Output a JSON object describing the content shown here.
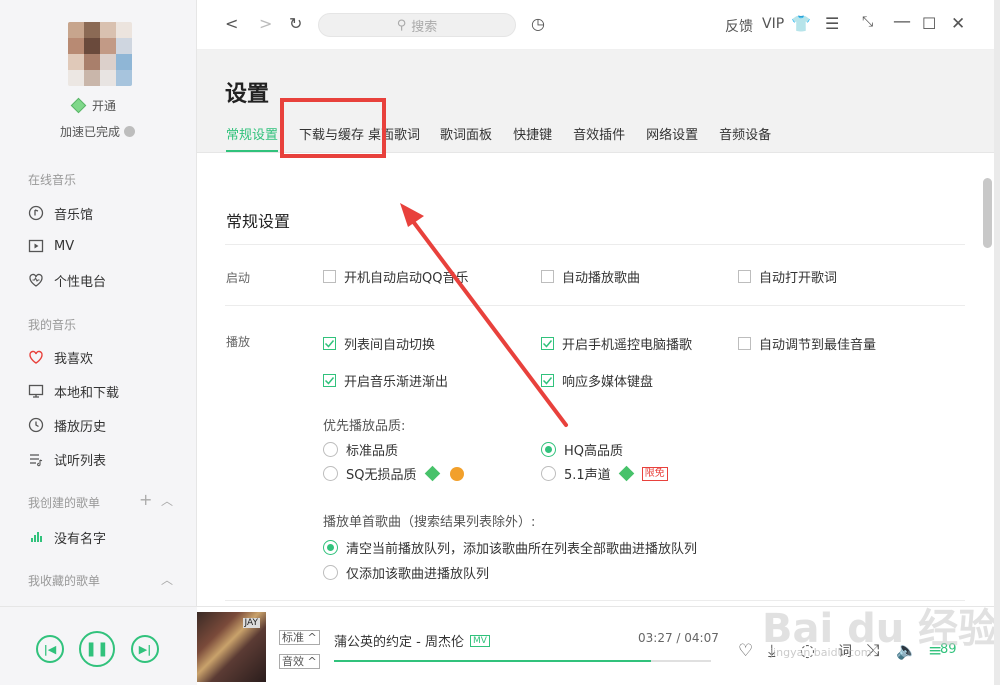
{
  "sidebar": {
    "vip_label": "开通",
    "speed_status": "加速已完成",
    "online_music_title": "在线音乐",
    "online_items": [
      {
        "label": "音乐馆",
        "icon": "music-hall-icon"
      },
      {
        "label": "MV",
        "icon": "mv-icon"
      },
      {
        "label": "个性电台",
        "icon": "radio-icon"
      }
    ],
    "my_music_title": "我的音乐",
    "my_items": [
      {
        "label": "我喜欢",
        "icon": "heart-icon"
      },
      {
        "label": "本地和下载",
        "icon": "monitor-icon"
      },
      {
        "label": "播放历史",
        "icon": "clock-icon"
      },
      {
        "label": "试听列表",
        "icon": "list-icon"
      }
    ],
    "created_title": "我创建的歌单",
    "created_item": "没有名字",
    "collected_title": "我收藏的歌单"
  },
  "topbar": {
    "search_placeholder": "搜索",
    "feedback": "反馈",
    "vip": "VIP"
  },
  "settings": {
    "title": "设置",
    "tabs": [
      "常规设置",
      "下载与缓存",
      "桌面歌词",
      "歌词面板",
      "快捷键",
      "音效插件",
      "网络设置",
      "音频设备"
    ],
    "active_tab": "常规设置",
    "section_title": "常规设置",
    "startup_label": "启动",
    "startup_options": [
      {
        "label": "开机自动启动QQ音乐",
        "checked": false
      },
      {
        "label": "自动播放歌曲",
        "checked": false
      },
      {
        "label": "自动打开歌词",
        "checked": false
      }
    ],
    "play_label": "播放",
    "play_options": [
      {
        "label": "列表间自动切换",
        "checked": true
      },
      {
        "label": "开启手机遥控电脑播歌",
        "checked": true
      },
      {
        "label": "自动调节到最佳音量",
        "checked": false
      },
      {
        "label": "开启音乐渐进渐出",
        "checked": true
      },
      {
        "label": "响应多媒体键盘",
        "checked": true
      }
    ],
    "quality_title": "优先播放品质:",
    "quality_options": [
      {
        "label": "标准品质",
        "selected": false
      },
      {
        "label": "HQ高品质",
        "selected": true
      },
      {
        "label": "SQ无损品质",
        "selected": false
      },
      {
        "label": "5.1声道",
        "selected": false
      }
    ],
    "limited_badge": "限免",
    "first_song_title": "播放单首歌曲（搜索结果列表除外）:",
    "first_song_options": [
      {
        "label": "清空当前播放队列，添加该歌曲所在列表全部歌曲进播放队列",
        "selected": true
      },
      {
        "label": "仅添加该歌曲进播放队列",
        "selected": false
      }
    ]
  },
  "player": {
    "cover_text": "JAY",
    "quality_btn": "标准",
    "effect_btn": "音效",
    "song_title": "蒲公英的约定 - 周杰伦",
    "mv_tag": "MV",
    "time": "03:27 / 04:07",
    "progress": 0.84,
    "count": "89"
  },
  "watermark": {
    "brand": "Bai du 经验",
    "url": "jingyan.baidu.com"
  },
  "colors": {
    "accent": "#31c27c",
    "annotation": "#e8413c"
  }
}
